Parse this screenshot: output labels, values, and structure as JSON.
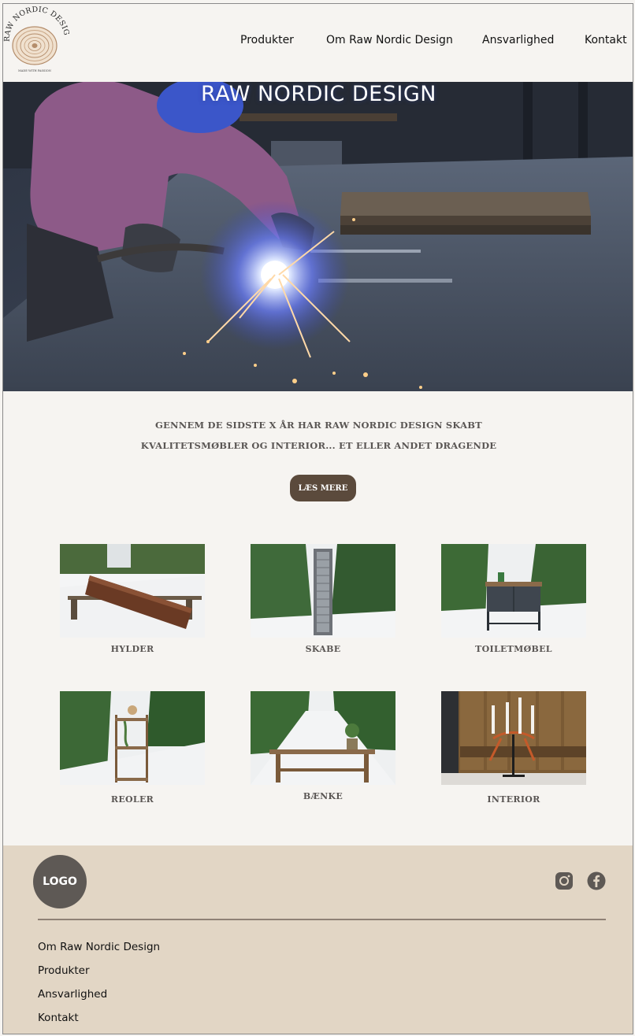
{
  "header": {
    "logo_text_top": "RAW NORDIC DESIGN",
    "logo_text_bottom": "MADE WITH PASSION",
    "nav": [
      {
        "label": "Produkter"
      },
      {
        "label": "Om Raw Nordic Design"
      },
      {
        "label": "Ansvarlighed"
      },
      {
        "label": "Kontakt"
      }
    ]
  },
  "hero": {
    "title": "RAW NORDIC DESIGN"
  },
  "intro": {
    "line1": "GENNEM DE SIDSTE X ÅR HAR RAW NORDIC DESIGN SKABT",
    "line2": "KVALITETSMØBLER OG INTERIOR... ET ELLER ANDET DRAGENDE",
    "button": "LÆS MERE"
  },
  "categories": [
    {
      "label": "HYLDER"
    },
    {
      "label": "SKABE"
    },
    {
      "label": "TOILETMØBEL"
    },
    {
      "label": "REOLER"
    },
    {
      "label": "BÆNKE"
    },
    {
      "label": "INTERIOR"
    }
  ],
  "footer": {
    "logo": "LOGO",
    "links": [
      {
        "label": "Om Raw Nordic Design"
      },
      {
        "label": "Produkter"
      },
      {
        "label": "Ansvarlighed"
      },
      {
        "label": "Kontakt"
      }
    ],
    "social": [
      "instagram-icon",
      "facebook-icon"
    ]
  },
  "colors": {
    "background": "#f6f4f1",
    "button": "#5b4a3c",
    "footer": "#e2d6c5",
    "text_muted": "#5a5654"
  }
}
